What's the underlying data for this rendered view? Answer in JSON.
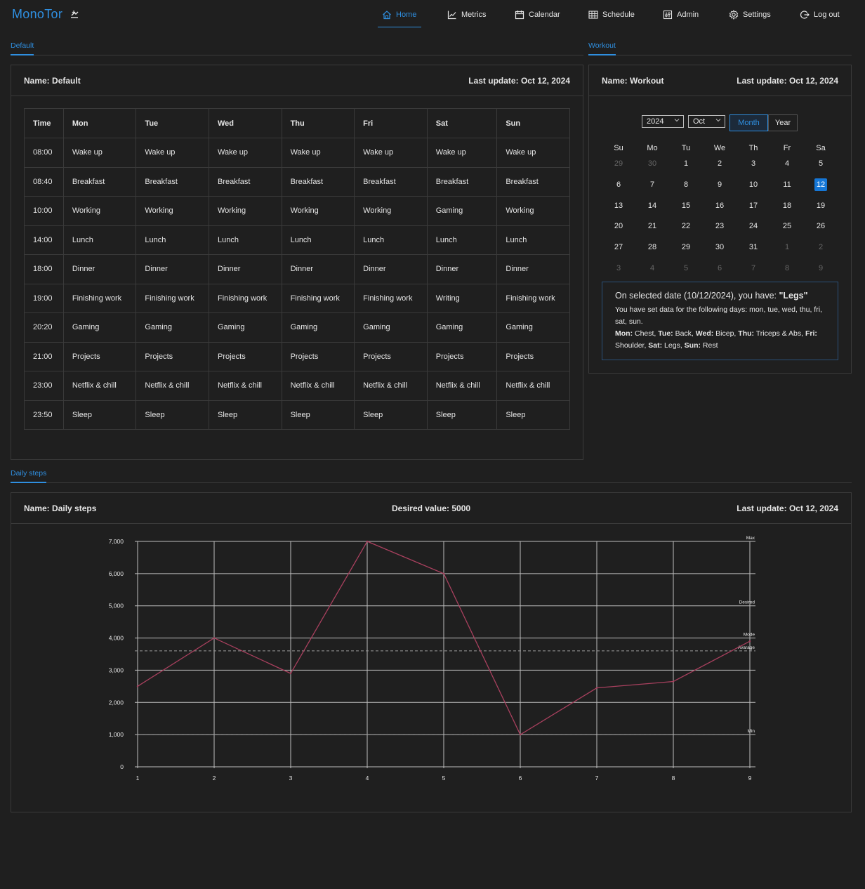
{
  "app": {
    "brand": "MonoTor",
    "nav": [
      {
        "label": "Home",
        "icon": "home-icon",
        "active": true
      },
      {
        "label": "Metrics",
        "icon": "chart-icon"
      },
      {
        "label": "Calendar",
        "icon": "calendar-icon"
      },
      {
        "label": "Schedule",
        "icon": "table-icon"
      },
      {
        "label": "Admin",
        "icon": "sliders-icon"
      },
      {
        "label": "Settings",
        "icon": "gear-icon"
      },
      {
        "label": "Log out",
        "icon": "logout-icon"
      }
    ],
    "accent": "#2f8fe0"
  },
  "default_tab": {
    "tab_label": "Default",
    "name_label": "Name:",
    "name_value": "Default",
    "update_label": "Last update:",
    "update_value": "Oct 12, 2024",
    "columns": [
      "Time",
      "Mon",
      "Tue",
      "Wed",
      "Thu",
      "Fri",
      "Sat",
      "Sun"
    ],
    "rows": [
      [
        "08:00",
        "Wake up",
        "Wake up",
        "Wake up",
        "Wake up",
        "Wake up",
        "Wake up",
        "Wake up"
      ],
      [
        "08:40",
        "Breakfast",
        "Breakfast",
        "Breakfast",
        "Breakfast",
        "Breakfast",
        "Breakfast",
        "Breakfast"
      ],
      [
        "10:00",
        "Working",
        "Working",
        "Working",
        "Working",
        "Working",
        "Gaming",
        "Working"
      ],
      [
        "14:00",
        "Lunch",
        "Lunch",
        "Lunch",
        "Lunch",
        "Lunch",
        "Lunch",
        "Lunch"
      ],
      [
        "18:00",
        "Dinner",
        "Dinner",
        "Dinner",
        "Dinner",
        "Dinner",
        "Dinner",
        "Dinner"
      ],
      [
        "19:00",
        "Finishing work",
        "Finishing work",
        "Finishing work",
        "Finishing work",
        "Finishing work",
        "Writing",
        "Finishing work"
      ],
      [
        "20:20",
        "Gaming",
        "Gaming",
        "Gaming",
        "Gaming",
        "Gaming",
        "Gaming",
        "Gaming"
      ],
      [
        "21:00",
        "Projects",
        "Projects",
        "Projects",
        "Projects",
        "Projects",
        "Projects",
        "Projects"
      ],
      [
        "23:00",
        "Netflix & chill",
        "Netflix & chill",
        "Netflix & chill",
        "Netflix & chill",
        "Netflix & chill",
        "Netflix & chill",
        "Netflix & chill"
      ],
      [
        "23:50",
        "Sleep",
        "Sleep",
        "Sleep",
        "Sleep",
        "Sleep",
        "Sleep",
        "Sleep"
      ]
    ]
  },
  "workout_tab": {
    "tab_label": "Workout",
    "name_label": "Name:",
    "name_value": "Workout",
    "update_label": "Last update:",
    "update_value": "Oct 12, 2024",
    "year_select": "2024",
    "month_select": "Oct",
    "mode_month": "Month",
    "mode_year": "Year",
    "weekdays": [
      "Su",
      "Mo",
      "Tu",
      "We",
      "Th",
      "Fr",
      "Sa"
    ],
    "weeks": [
      [
        [
          "29",
          true
        ],
        [
          "30",
          true
        ],
        [
          "1",
          false
        ],
        [
          "2",
          false
        ],
        [
          "3",
          false
        ],
        [
          "4",
          false
        ],
        [
          "5",
          false
        ]
      ],
      [
        [
          "6",
          false
        ],
        [
          "7",
          false
        ],
        [
          "8",
          false
        ],
        [
          "9",
          false
        ],
        [
          "10",
          false
        ],
        [
          "11",
          false
        ],
        [
          "12",
          false
        ]
      ],
      [
        [
          "13",
          false
        ],
        [
          "14",
          false
        ],
        [
          "15",
          false
        ],
        [
          "16",
          false
        ],
        [
          "17",
          false
        ],
        [
          "18",
          false
        ],
        [
          "19",
          false
        ]
      ],
      [
        [
          "20",
          false
        ],
        [
          "21",
          false
        ],
        [
          "22",
          false
        ],
        [
          "23",
          false
        ],
        [
          "24",
          false
        ],
        [
          "25",
          false
        ],
        [
          "26",
          false
        ]
      ],
      [
        [
          "27",
          false
        ],
        [
          "28",
          false
        ],
        [
          "29",
          false
        ],
        [
          "30",
          false
        ],
        [
          "31",
          false
        ],
        [
          "1",
          true
        ],
        [
          "2",
          true
        ]
      ],
      [
        [
          "3",
          true
        ],
        [
          "4",
          true
        ],
        [
          "5",
          true
        ],
        [
          "6",
          true
        ],
        [
          "7",
          true
        ],
        [
          "8",
          true
        ],
        [
          "9",
          true
        ]
      ]
    ],
    "selected_day": "12",
    "info_prefix": "On selected date (10/12/2024), you have: ",
    "info_value": "\"Legs\"",
    "info_days": "You have set data for the following days: mon, tue, wed, thu, fri, sat, sun.",
    "plan": [
      {
        "day": "Mon:",
        "value": "Chest"
      },
      {
        "day": "Tue:",
        "value": "Back"
      },
      {
        "day": "Wed:",
        "value": "Bicep"
      },
      {
        "day": "Thu:",
        "value": "Triceps & Abs"
      },
      {
        "day": "Fri:",
        "value": "Shoulder"
      },
      {
        "day": "Sat:",
        "value": "Legs"
      },
      {
        "day": "Sun:",
        "value": "Rest"
      }
    ]
  },
  "steps_tab": {
    "tab_label": "Daily steps",
    "name_label": "Name:",
    "name_value": "Daily steps",
    "desired_label": "Desired value:",
    "desired_value": "5000",
    "update_label": "Last update:",
    "update_value": "Oct 12, 2024"
  },
  "chart_data": {
    "type": "line",
    "x": [
      1,
      2,
      3,
      4,
      5,
      6,
      7,
      8,
      9
    ],
    "series": [
      {
        "values": [
          2500,
          4000,
          2900,
          7000,
          6000,
          1000,
          2450,
          2650,
          3900
        ],
        "color": "#a8405e"
      }
    ],
    "ylim": [
      0,
      7000
    ],
    "yticks": [
      "0",
      "1,000",
      "2,000",
      "3,000",
      "4,000",
      "5,000",
      "6,000",
      "7,000"
    ],
    "xticks": [
      "1",
      "2",
      "3",
      "4",
      "5",
      "6",
      "7",
      "8",
      "9"
    ],
    "reference_lines": [
      {
        "label": "Max",
        "value": 7000,
        "dashed": false
      },
      {
        "label": "Desired",
        "value": 5000,
        "dashed": false
      },
      {
        "label": "Mode",
        "value": 4000,
        "dashed": false
      },
      {
        "label": "Avarage",
        "value": 3600,
        "dashed": true
      },
      {
        "label": "Min",
        "value": 1000,
        "dashed": true
      }
    ],
    "grid": true
  }
}
